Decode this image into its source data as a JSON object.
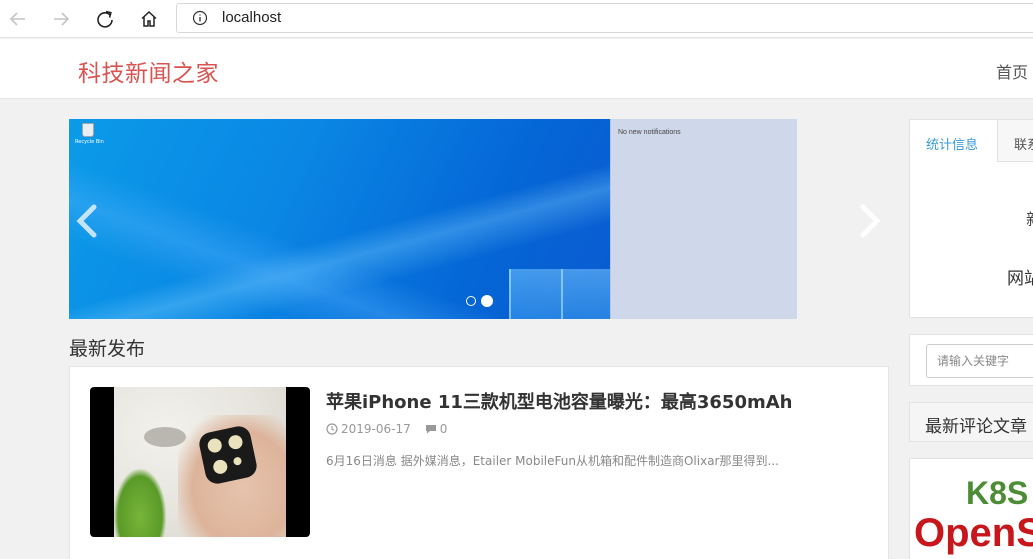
{
  "browser": {
    "url": "localhost"
  },
  "site": {
    "logo": "科技新闻之家",
    "nav_home": "首页"
  },
  "carousel": {
    "notification_text": "No new notifications",
    "desktop_icon_label": "Recycle Bin",
    "slide_count": 2,
    "active_slide": 2
  },
  "latest": {
    "title": "最新发布",
    "post": {
      "title": "苹果iPhone 11三款机型电池容量曝光：最高3650mAh",
      "date": "2019-06-17",
      "comments": "0",
      "excerpt": "6月16日消息 据外媒消息，Etailer MobileFun从机箱和配件制造商Olixar那里得到..."
    }
  },
  "sidebar": {
    "tabs": {
      "active": "统计信息",
      "other": "联系"
    },
    "stat_fragment_1": "新",
    "stat_fragment_2": "网站",
    "search_placeholder": "请输入关键字",
    "comments_header": "最新评论文章",
    "ad": {
      "line1": "K8S",
      "line2": "OpenS"
    }
  },
  "colors": {
    "logo": "#d9534f",
    "tab_active": "#3a9bd9",
    "ad_green": "#4c8c34",
    "ad_red": "#c8171c"
  }
}
